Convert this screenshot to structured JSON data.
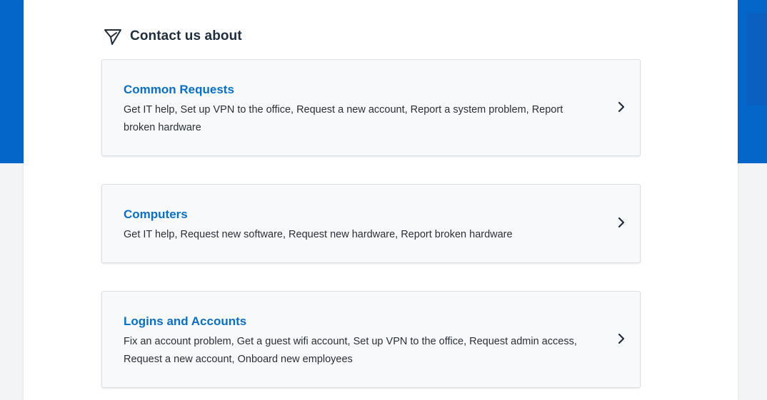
{
  "section": {
    "heading": "Contact us about",
    "heading_icon": "send-paper-plane-icon"
  },
  "categories": [
    {
      "title": "Common Requests",
      "description": "Get IT help, Set up VPN to the office, Request a new account, Report a system problem, Report broken hardware",
      "icon": "chevron-right-icon"
    },
    {
      "title": "Computers",
      "description": "Get IT help, Request new software, Request new hardware, Report broken hardware",
      "icon": "chevron-right-icon"
    },
    {
      "title": "Logins and Accounts",
      "description": "Fix an account problem, Get a guest wifi account, Set up VPN to the office, Request admin access, Request a new account, Onboard new employees",
      "icon": "chevron-right-icon"
    }
  ],
  "colors": {
    "brand_blue": "#0466c8",
    "link_blue": "#0a6fc2",
    "heading_text": "#1f2d3d",
    "body_text": "#2b2f36",
    "card_bg": "#f8f9fb"
  }
}
